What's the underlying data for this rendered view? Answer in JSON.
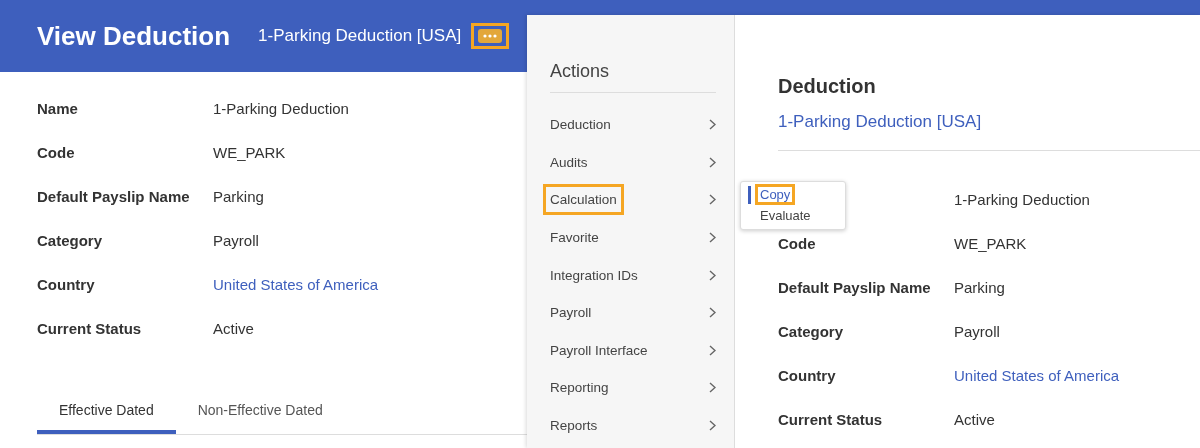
{
  "header": {
    "title": "View Deduction",
    "subtitle": "1-Parking Deduction [USA]",
    "more_button": {
      "highlighted": true
    }
  },
  "details": [
    {
      "label": "Name",
      "value": "1-Parking Deduction",
      "kind": "text"
    },
    {
      "label": "Code",
      "value": "WE_PARK",
      "kind": "text"
    },
    {
      "label": "Default Payslip Name",
      "value": "Parking",
      "kind": "text"
    },
    {
      "label": "Category",
      "value": "Payroll",
      "kind": "text"
    },
    {
      "label": "Country",
      "value": "United States of America",
      "kind": "link"
    },
    {
      "label": "Current Status",
      "value": "Active",
      "kind": "text"
    }
  ],
  "tabs": [
    {
      "label": "Effective Dated",
      "selected": true
    },
    {
      "label": "Non-Effective Dated",
      "selected": false
    }
  ],
  "actions_menu": {
    "title": "Actions",
    "items": [
      {
        "label": "Deduction",
        "highlighted": false
      },
      {
        "label": "Audits",
        "highlighted": false
      },
      {
        "label": "Calculation",
        "highlighted": true
      },
      {
        "label": "Favorite",
        "highlighted": false
      },
      {
        "label": "Integration IDs",
        "highlighted": false
      },
      {
        "label": "Payroll",
        "highlighted": false
      },
      {
        "label": "Payroll Interface",
        "highlighted": false
      },
      {
        "label": "Reporting",
        "highlighted": false
      },
      {
        "label": "Reports",
        "highlighted": false
      }
    ]
  },
  "submenu": {
    "items": [
      {
        "label": "Copy",
        "selected": true,
        "highlighted": true
      },
      {
        "label": "Evaluate",
        "selected": false,
        "highlighted": false
      }
    ]
  },
  "preview_panel": {
    "title": "Deduction",
    "link": "1-Parking Deduction [USA]",
    "fields": [
      {
        "value": "1-Parking Deduction",
        "kind": "text"
      },
      {
        "label": "Code",
        "value": "WE_PARK",
        "kind": "text"
      },
      {
        "label": "Default Payslip Name",
        "value": "Parking",
        "kind": "text"
      },
      {
        "label": "Category",
        "value": "Payroll",
        "kind": "text"
      },
      {
        "label": "Country",
        "value": "United States of America",
        "kind": "link"
      },
      {
        "label": "Current Status",
        "value": "Active",
        "kind": "text"
      }
    ]
  }
}
